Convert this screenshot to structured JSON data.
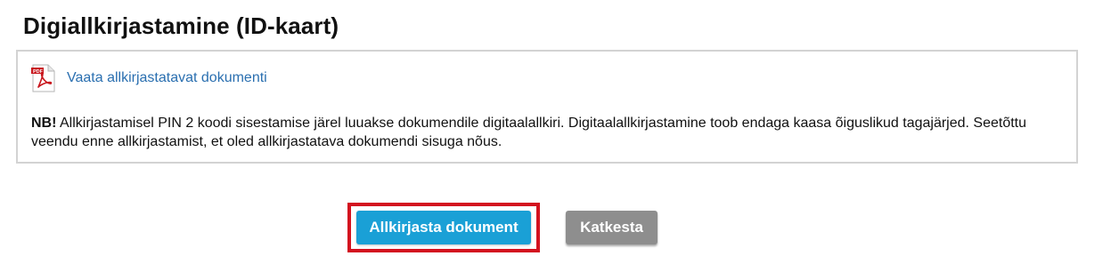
{
  "page": {
    "title": "Digiallkirjastamine (ID-kaart)"
  },
  "document": {
    "icon": "pdf-icon",
    "link_label": "Vaata allkirjastatavat dokumenti"
  },
  "notice": {
    "prefix": "NB!",
    "text": " Allkirjastamisel PIN 2 koodi sisestamise järel luuakse dokumendile digitaalallkiri. Digitaalallkirjastamine toob endaga kaasa õiguslikud tagajärjed. Seetõttu veendu enne allkirjastamist, et oled allkirjastatava dokumendi sisuga nõus."
  },
  "actions": {
    "sign_label": "Allkirjasta dokument",
    "cancel_label": "Katkesta"
  },
  "colors": {
    "link": "#2a6fb0",
    "primary_button": "#1aa0d6",
    "secondary_button": "#8e8e8e",
    "highlight_frame": "#d3121f",
    "box_border": "#d3d3d3"
  }
}
